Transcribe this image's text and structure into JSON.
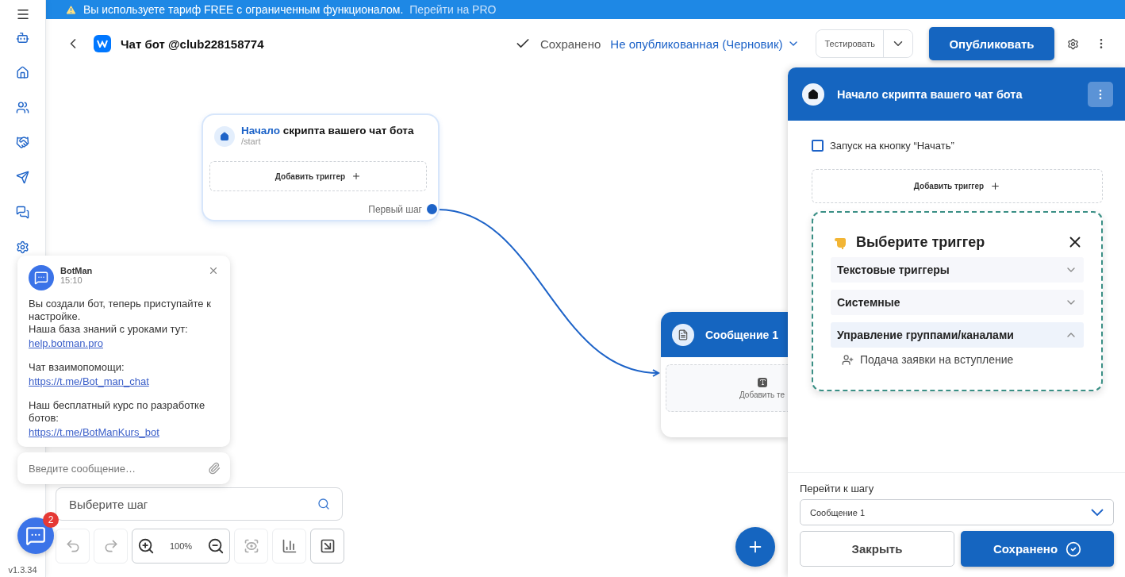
{
  "banner": {
    "message": "Вы используете тариф FREE с ограниченным функционалом.",
    "link": "Перейти на PRO"
  },
  "header": {
    "title": "Чат бот @club228158774",
    "save_status": "Сохранено",
    "publish_status": "Не опубликованная (Черновик)",
    "test_button": "Тестировать",
    "publish_button": "Опубликовать"
  },
  "sidebar": {
    "version": "v1.3.34"
  },
  "start_node": {
    "title_accent": "Начало",
    "title": "скрипта вашего чат бота",
    "command": "/start",
    "add_trigger": "Добавить триггер",
    "output": "Первый шаг"
  },
  "message_node": {
    "title": "Сообщение 1",
    "add_text": "Добавить те"
  },
  "toolbar": {
    "search_placeholder": "Выберите шаг",
    "zoom": "100%"
  },
  "chat": {
    "sender": "BotMan",
    "time": "15:10",
    "messages": [
      {
        "lines": [
          "Вы создали бот, теперь приступайте к настройке.",
          "Наша база знаний с уроками тут:"
        ],
        "link": "help.botman.pro"
      },
      {
        "lines": [
          "Чат взаимопомощи:"
        ],
        "link": "https://t.me/Bot_man_chat"
      },
      {
        "lines": [
          "Наш бесплатный курс по разработке ботов:"
        ],
        "link": "https://t.me/BotManKurs_bot"
      }
    ],
    "input_placeholder": "Введите сообщение…",
    "unread": "2"
  },
  "panel": {
    "title": "Начало скрипта вашего чат бота",
    "checkbox": {
      "label": "Запуск на кнопку “Начать”",
      "checked": false
    },
    "add_trigger": "Добавить триггер",
    "picker": {
      "title": "Выберите триггер",
      "groups": [
        {
          "label": "Текстовые триггеры",
          "expanded": false
        },
        {
          "label": "Системные",
          "expanded": false
        },
        {
          "label": "Управление группами/каналами",
          "expanded": true,
          "items": [
            "Подача заявки на вступление"
          ]
        }
      ]
    },
    "goto_label": "Перейти к шагу",
    "goto_value": "Сообщение 1",
    "close_button": "Закрыть",
    "save_button": "Сохранено"
  }
}
